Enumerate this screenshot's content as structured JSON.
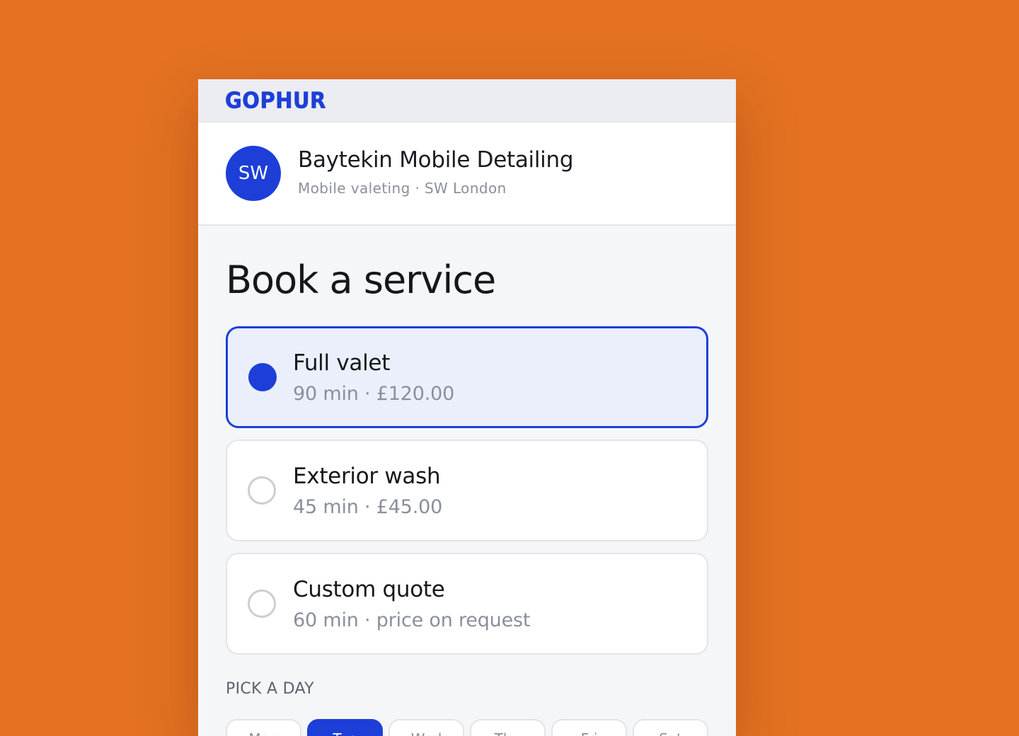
{
  "header": {
    "logo_text": "GOPHUR"
  },
  "business": {
    "avatar_initials": "SW",
    "name": "Baytekin Mobile Detailing",
    "subtitle": "Mobile valeting · SW London"
  },
  "page": {
    "title": "Book a service"
  },
  "services": [
    {
      "name": "Full valet",
      "meta": "90 min · £120.00",
      "selected": true
    },
    {
      "name": "Exterior wash",
      "meta": "45 min · £45.00",
      "selected": false
    },
    {
      "name": "Custom quote",
      "meta": "60 min · price on request",
      "selected": false
    }
  ],
  "day_picker": {
    "label": "PICK A DAY",
    "days": [
      {
        "label": "Mon",
        "selected": false
      },
      {
        "label": "Tue",
        "selected": true
      },
      {
        "label": "Wed",
        "selected": false
      },
      {
        "label": "Thu",
        "selected": false
      },
      {
        "label": "Fri",
        "selected": false
      },
      {
        "label": "Sat",
        "selected": false
      }
    ]
  },
  "colors": {
    "background": "#E47222",
    "accent": "#1D3FD8",
    "selected_card": "#EAEFFB"
  }
}
